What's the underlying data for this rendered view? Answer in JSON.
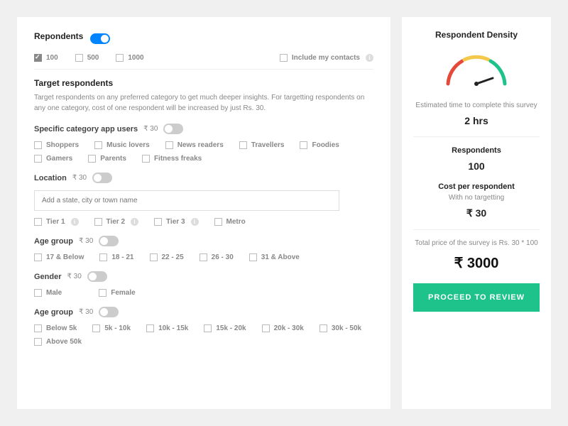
{
  "respondents": {
    "label": "Repondents",
    "options": [
      "100",
      "500",
      "1000"
    ],
    "include_contacts": "Include my contacts"
  },
  "target": {
    "title": "Target respondents",
    "subtitle": "Target respondents on any preferred category to get much deeper insights. For targetting respondents on any one category, cost of one respondent will be increased by just Rs. 30."
  },
  "category": {
    "label": "Specific category app users",
    "price": "₹ 30",
    "options": [
      "Shoppers",
      "Music lovers",
      "News readers",
      "Travellers",
      "Foodies",
      "Gamers",
      "Parents",
      "Fitness freaks"
    ]
  },
  "location": {
    "label": "Location",
    "price": "₹ 30",
    "placeholder": "Add a state, city or town name",
    "options": [
      "Tier 1",
      "Tier 2",
      "Tier 3",
      "Metro"
    ]
  },
  "age": {
    "label": "Age group",
    "price": "₹ 30",
    "options": [
      "17 & Below",
      "18 - 21",
      "22 - 25",
      "26 - 30",
      "31 & Above"
    ]
  },
  "gender": {
    "label": "Gender",
    "price": "₹ 30",
    "options": [
      "Male",
      "Female"
    ]
  },
  "income": {
    "label": "Age group",
    "price": "₹ 30",
    "options": [
      "Below 5k",
      "5k - 10k",
      "10k - 15k",
      "15k - 20k",
      "20k - 30k",
      "30k - 50k",
      "Above 50k"
    ]
  },
  "side": {
    "density_title": "Respondent Density",
    "time_label": "Estimated time to complete this survey",
    "time_value": "2 hrs",
    "resp_label": "Respondents",
    "resp_value": "100",
    "cost_label": "Cost per respondent",
    "cost_sub": "With no targetting",
    "cost_value": "₹ 30",
    "total_label": "Total price of the survey is Rs. 30 * 100",
    "total_value": "₹ 3000",
    "button": "PROCEED TO REVIEW"
  }
}
